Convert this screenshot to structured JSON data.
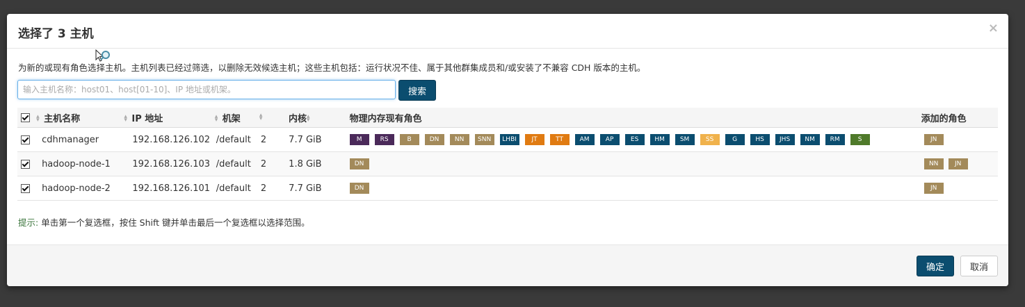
{
  "dialog": {
    "title": "选择了 3 主机",
    "close_glyph": "×",
    "description": "为新的或现有角色选择主机。主机列表已经过筛选，以删除无效候选主机；这些主机包括：运行状况不佳、属于其他群集成员和/或安装了不兼容 CDH 版本的主机。"
  },
  "search": {
    "placeholder": "输入主机名称：host01、host[01-10]、IP 地址或机架。",
    "value": "",
    "button_label": "搜索"
  },
  "table": {
    "headers": {
      "name": "主机名称",
      "ip": "IP 地址",
      "rack": "机架",
      "cores": "内核",
      "memory": "物理内存",
      "existing_roles": "现有角色",
      "added_roles": "添加的角色"
    },
    "rows": [
      {
        "name": "cdhmanager",
        "ip": "192.168.126.102",
        "rack": "/default",
        "cores": "2",
        "memory": "7.7 GiB",
        "existing_roles": [
          {
            "label": "M",
            "color": "#4b2a5a"
          },
          {
            "label": "RS",
            "color": "#4b2a5a"
          },
          {
            "label": "B",
            "color": "#a38a5a"
          },
          {
            "label": "DN",
            "color": "#a38a5a"
          },
          {
            "label": "NN",
            "color": "#a38a5a"
          },
          {
            "label": "SNN",
            "color": "#a38a5a"
          },
          {
            "label": "LHBI",
            "color": "#0b4d6f"
          },
          {
            "label": "JT",
            "color": "#e07b12"
          },
          {
            "label": "TT",
            "color": "#e07b12"
          },
          {
            "label": "AM",
            "color": "#0b4d6f"
          },
          {
            "label": "AP",
            "color": "#0b4d6f"
          },
          {
            "label": "ES",
            "color": "#0b4d6f"
          },
          {
            "label": "HM",
            "color": "#0b4d6f"
          },
          {
            "label": "SM",
            "color": "#0b4d6f"
          },
          {
            "label": "SS",
            "color": "#f0b24c"
          },
          {
            "label": "G",
            "color": "#0b4d6f"
          },
          {
            "label": "HS",
            "color": "#0b4d6f"
          },
          {
            "label": "JHS",
            "color": "#0b4d6f"
          },
          {
            "label": "NM",
            "color": "#0b4d6f"
          },
          {
            "label": "RM",
            "color": "#0b4d6f"
          },
          {
            "label": "S",
            "color": "#4f7a2a"
          }
        ],
        "added_roles": [
          {
            "label": "JN",
            "color": "#a38a5a"
          }
        ]
      },
      {
        "name": "hadoop-node-1",
        "ip": "192.168.126.103",
        "rack": "/default",
        "cores": "2",
        "memory": "1.8 GiB",
        "existing_roles": [
          {
            "label": "DN",
            "color": "#a38a5a"
          }
        ],
        "added_roles": [
          {
            "label": "NN",
            "color": "#a38a5a"
          },
          {
            "label": "JN",
            "color": "#a38a5a"
          }
        ]
      },
      {
        "name": "hadoop-node-2",
        "ip": "192.168.126.101",
        "rack": "/default",
        "cores": "2",
        "memory": "7.7 GiB",
        "existing_roles": [
          {
            "label": "DN",
            "color": "#a38a5a"
          }
        ],
        "added_roles": [
          {
            "label": "JN",
            "color": "#a38a5a"
          }
        ]
      }
    ]
  },
  "hint": {
    "label": "提示:",
    "text": " 单击第一个复选框，按住 Shift 键并单击最后一个复选框以选择范围。"
  },
  "footer": {
    "ok_label": "确定",
    "cancel_label": "取消"
  },
  "colors": {
    "primary": "#0b4d6f",
    "hint_green": "#3c763d"
  }
}
